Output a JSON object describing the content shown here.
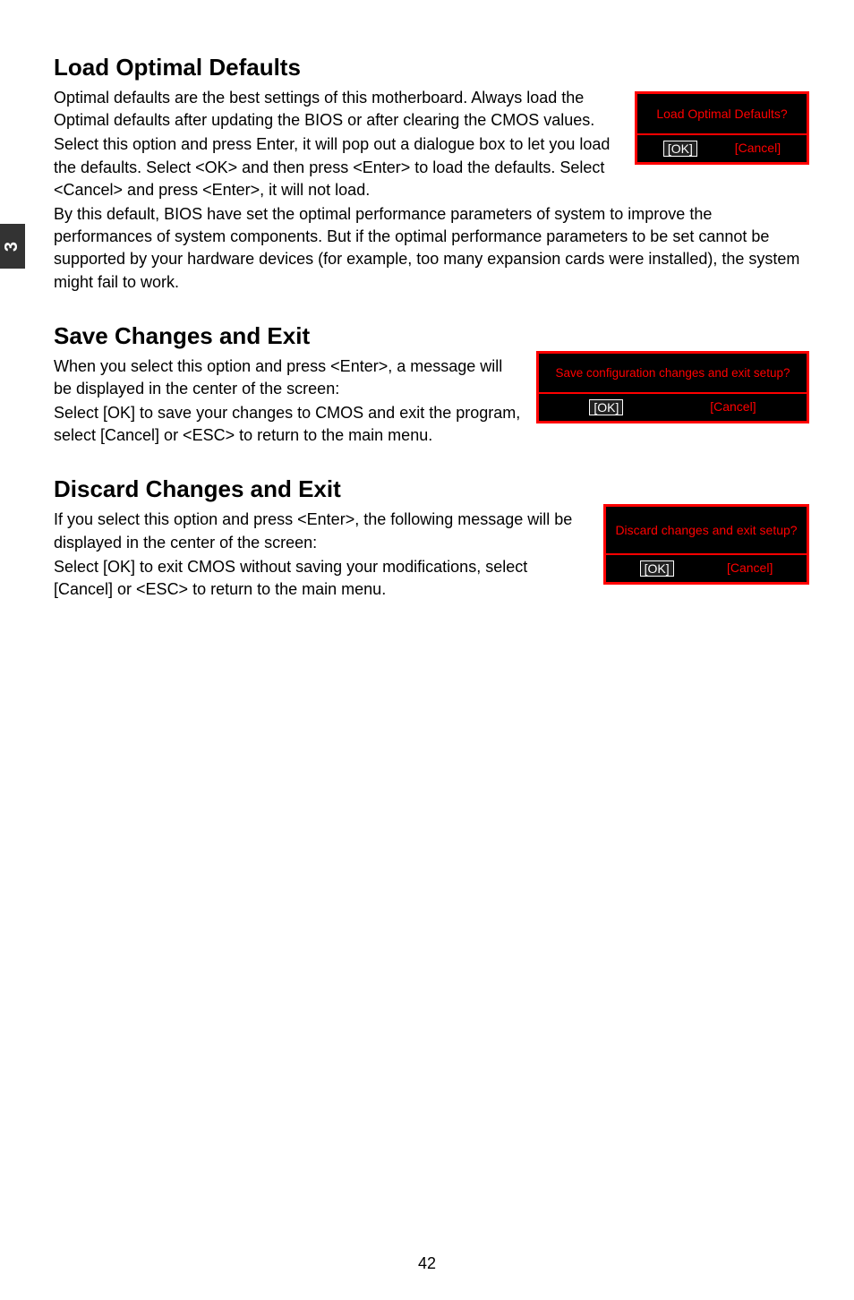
{
  "side_tab": "3",
  "page_number": "42",
  "sections": {
    "s1": {
      "heading": "Load Optimal Defaults",
      "p1": "Optimal defaults are the best settings of this motherboard. Always load the Optimal defaults after updating the BIOS or after clearing the CMOS values.",
      "p2": "Select this option and press Enter, it will pop out a dialogue box to let you load the defaults. Select <OK> and then press <Enter> to load the defaults. Select <Cancel> and press <Enter>, it will not load.",
      "p3": "By this default, BIOS have set the optimal performance parameters of system to improve the performances of system components. But if the optimal performance parameters to be set cannot be supported by your hardware devices (for example, too many expansion cards were installed), the system might fail to work.",
      "dialog": {
        "title": "Load Optimal Defaults?",
        "ok": "[OK]",
        "cancel": "[Cancel]"
      }
    },
    "s2": {
      "heading": "Save Changes and Exit",
      "p1": "When you select this option and press <Enter>, a message will be displayed in the center of the screen:",
      "p2": "Select [OK] to save your changes to CMOS and exit the program, select [Cancel] or <ESC> to return to the main menu.",
      "dialog": {
        "title": "Save configuration changes and exit setup?",
        "ok": "[OK]",
        "cancel": "[Cancel]"
      }
    },
    "s3": {
      "heading": "Discard Changes and Exit",
      "p1": "If you select this option and press <Enter>, the following message will be displayed in the center of the screen:",
      "p2": "Select [OK] to exit CMOS without saving your modifications, select [Cancel] or <ESC> to return to the main menu.",
      "dialog": {
        "title": "Discard changes and exit setup?",
        "ok": "[OK]",
        "cancel": "[Cancel]"
      }
    }
  }
}
